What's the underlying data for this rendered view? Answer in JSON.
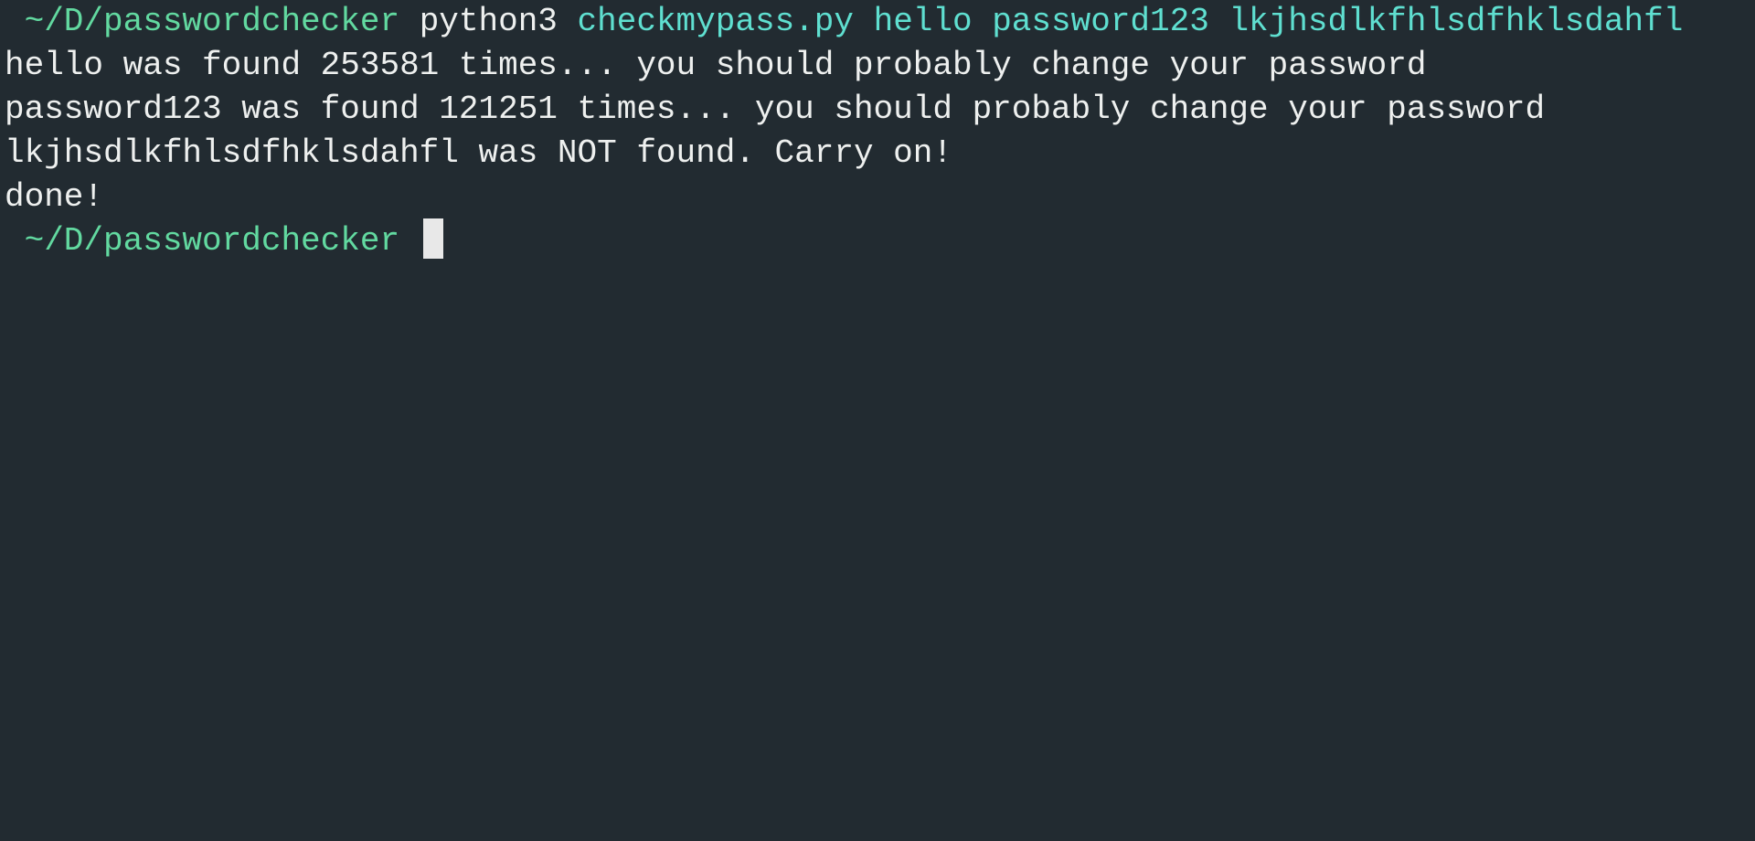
{
  "colors": {
    "background": "#222b31",
    "prompt_path": "#62d9a0",
    "command": "#eef0ef",
    "arguments": "#5fdfd0",
    "output": "#eef0ef"
  },
  "prompt1": {
    "path": " ~/D/passwordchecker",
    "command": "python3",
    "args": "checkmypass.py hello password123 lkjhsdlkfhlsdfhklsdahfl"
  },
  "output": [
    "hello was found 253581 times... you should probably change your password",
    "password123 was found 121251 times... you should probably change your password",
    "lkjhsdlkfhlsdfhklsdahfl was NOT found. Carry on!",
    "done!"
  ],
  "prompt2": {
    "path": " ~/D/passwordchecker"
  }
}
